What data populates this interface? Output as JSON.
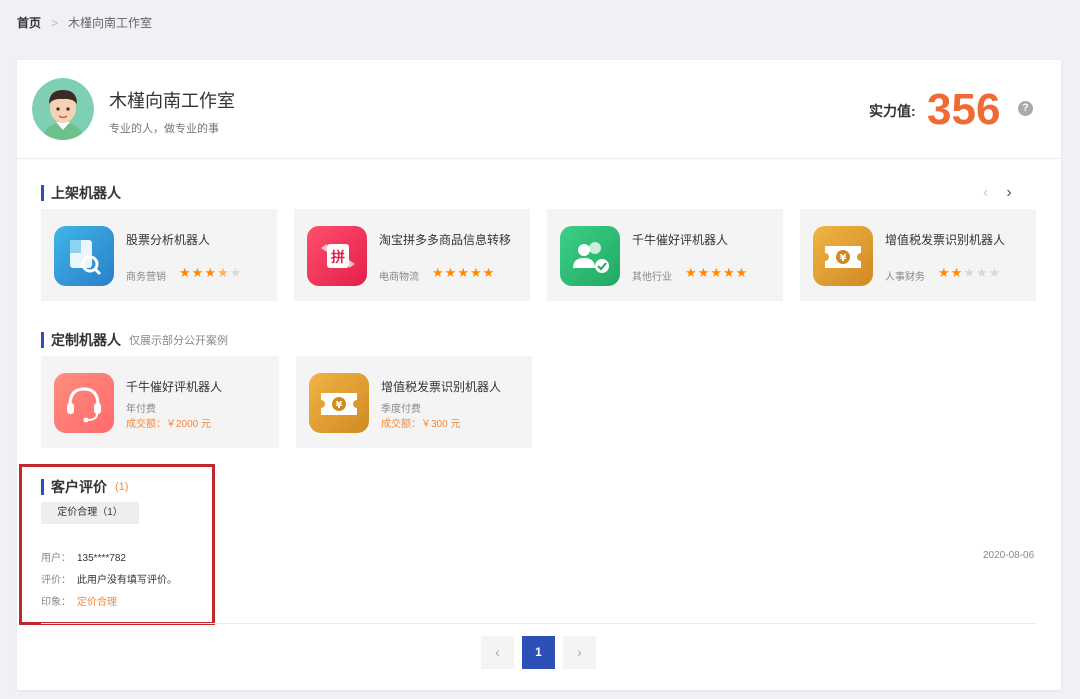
{
  "breadcrumb": {
    "home": "首页",
    "separator": ">",
    "current": "木槿向南工作室"
  },
  "profile": {
    "name": "木槿向南工作室",
    "slogan": "专业的人，做专业的事",
    "power_label": "实力值:",
    "power_value": "356",
    "help": "?"
  },
  "listed": {
    "title": "上架机器人",
    "prev": "‹",
    "next": "›",
    "items": [
      {
        "name": "股票分析机器人",
        "category": "商务营销",
        "rating": 3.5,
        "icon": "stock-analysis-icon",
        "color": "#3aa6dd"
      },
      {
        "name": "淘宝拼多多商品信息转移",
        "category": "电商物流",
        "rating": 5,
        "icon": "pinduoduo-transfer-icon",
        "color": "#f2365b"
      },
      {
        "name": "千牛催好评机器人",
        "category": "其他行业",
        "rating": 5,
        "icon": "review-users-icon",
        "color": "#2fbd73"
      },
      {
        "name": "增值税发票识别机器人",
        "category": "人事财务",
        "rating": 2,
        "icon": "invoice-ticket-icon",
        "color": "#e0a030"
      }
    ]
  },
  "custom": {
    "title": "定制机器人",
    "subtitle": "仅展示部分公开案例",
    "items": [
      {
        "name": "千牛催好评机器人",
        "pay": "年付费",
        "deal": "成交额：￥2000 元",
        "icon": "headset-icon",
        "color": "#ff7a78"
      },
      {
        "name": "增值税发票识别机器人",
        "pay": "季度付费",
        "deal": "成交额：￥300 元",
        "icon": "invoice-ticket-icon",
        "color": "#e0a030"
      }
    ]
  },
  "reviews": {
    "title": "客户评价",
    "count": "(1)",
    "tag": "定价合理（1）",
    "user_label": "用户：",
    "user_value": "135****782",
    "comment_label": "评价：",
    "comment_value": "此用户没有填写评价。",
    "impression_label": "印象：",
    "impression_value": "定价合理",
    "date": "2020-08-06"
  },
  "pagination": {
    "prev": "‹",
    "current": "1",
    "next": "›"
  }
}
